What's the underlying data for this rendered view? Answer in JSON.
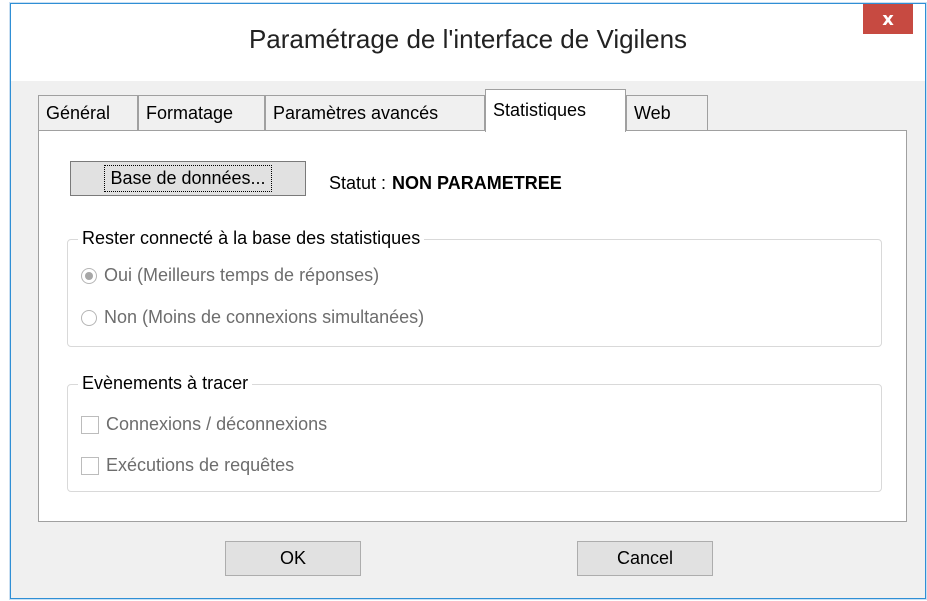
{
  "window": {
    "title": "Paramétrage de l'interface de Vigilens",
    "close_label": "x"
  },
  "tabs": [
    {
      "label": "Général",
      "active": false
    },
    {
      "label": "Formatage",
      "active": false
    },
    {
      "label": "Paramètres avancés",
      "active": false
    },
    {
      "label": "Statistiques",
      "active": true
    },
    {
      "label": "Web",
      "active": false
    }
  ],
  "statistics": {
    "db_button_label": "Base de données...",
    "status_label": "Statut :",
    "status_value": "NON PARAMETREE",
    "connection_group": {
      "legend": "Rester connecté à la base des statistiques",
      "options": [
        {
          "label": "Oui (Meilleurs temps de réponses)",
          "checked": true
        },
        {
          "label": "Non (Moins de connexions simultanées)",
          "checked": false
        }
      ]
    },
    "events_group": {
      "legend": "Evènements à tracer",
      "options": [
        {
          "label": "Connexions / déconnexions",
          "checked": false
        },
        {
          "label": "Exécutions de requêtes",
          "checked": false
        }
      ]
    }
  },
  "footer": {
    "ok_label": "OK",
    "cancel_label": "Cancel"
  }
}
